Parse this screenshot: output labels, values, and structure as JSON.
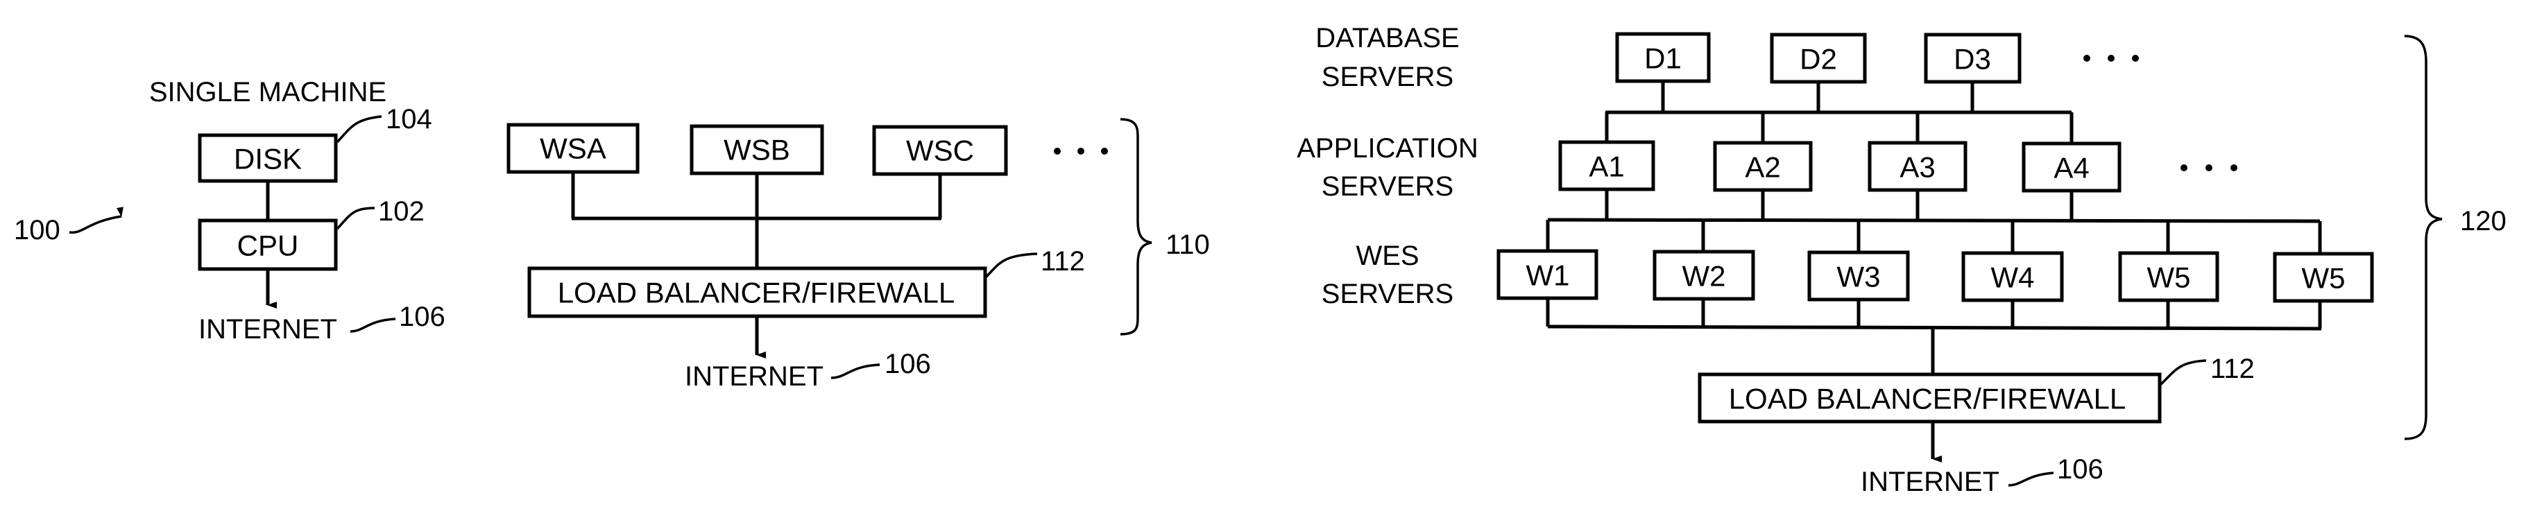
{
  "single_machine": {
    "title": "SINGLE MACHINE",
    "disk": "DISK",
    "cpu": "CPU",
    "internet": "INTERNET",
    "ref_system": "100",
    "ref_disk": "104",
    "ref_cpu": "102",
    "ref_internet": "106"
  },
  "cluster": {
    "servers": [
      "WSA",
      "WSB",
      "WSC"
    ],
    "load_balancer": "LOAD BALANCER/FIREWALL",
    "internet": "INTERNET",
    "ref_load_balancer": "112",
    "ref_internet": "106",
    "ref_group": "110"
  },
  "tiered": {
    "tier_labels": {
      "database": [
        "DATABASE",
        "SERVERS"
      ],
      "application": [
        "APPLICATION",
        "SERVERS"
      ],
      "web": [
        "WES",
        "SERVERS"
      ]
    },
    "database_servers": [
      "D1",
      "D2",
      "D3"
    ],
    "application_servers": [
      "A1",
      "A2",
      "A3",
      "A4"
    ],
    "web_servers": [
      "W1",
      "W2",
      "W3",
      "W4",
      "W5",
      "W5"
    ],
    "load_balancer": "LOAD BALANCER/FIREWALL",
    "internet": "INTERNET",
    "ref_load_balancer": "112",
    "ref_internet": "106",
    "ref_group": "120"
  }
}
